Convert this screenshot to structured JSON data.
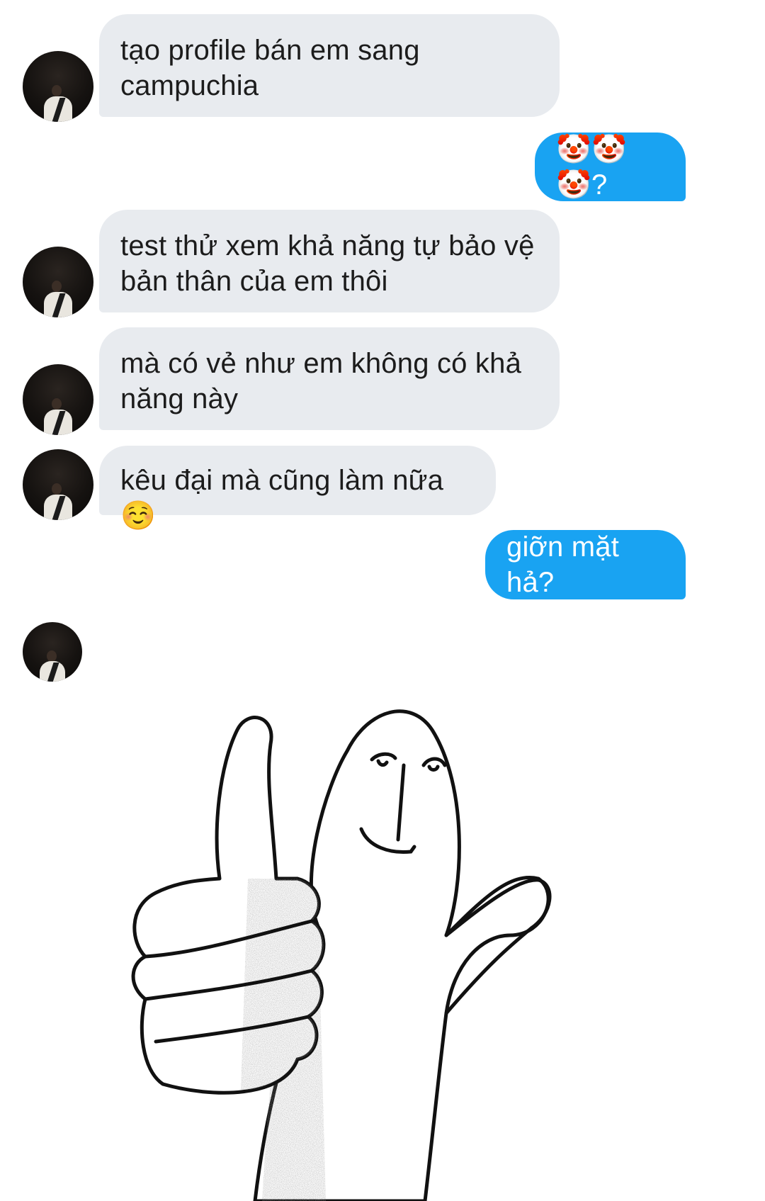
{
  "messages": [
    {
      "direction": "incoming",
      "text": "tạo profile bán em sang campuchia"
    },
    {
      "direction": "outgoing",
      "text": "🤡🤡🤡?"
    },
    {
      "direction": "incoming",
      "text": "test thử xem khả năng tự bảo vệ bản thân của em thôi"
    },
    {
      "direction": "incoming",
      "text": "mà có vẻ như em không có khả năng này"
    },
    {
      "direction": "incoming",
      "text": "kêu đại mà cũng làm nữa ☺️"
    },
    {
      "direction": "outgoing",
      "text": "giỡn mặt hả?"
    },
    {
      "direction": "incoming",
      "type": "sticker",
      "sticker": "thumbs-up-doodle-sticker"
    }
  ],
  "colors": {
    "incoming_bubble": "#e8ebef",
    "outgoing_bubble": "#19a3f2",
    "incoming_text": "#1c1c1c",
    "outgoing_text": "#ffffff",
    "background": "#ffffff"
  }
}
